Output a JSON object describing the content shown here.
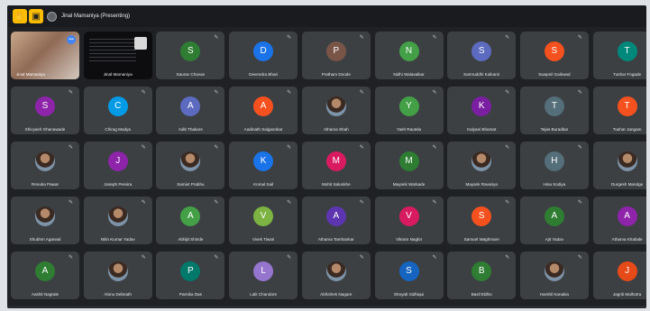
{
  "topbar": {
    "presenter_label": "Jinal Mamaniya (Presenting)"
  },
  "colors": {
    "bg": "#202124",
    "tile": "#3c4043",
    "badge": "#4285f4"
  },
  "tiles": [
    {
      "name": "Jinal Mamaniya",
      "kind": "video"
    },
    {
      "name": "Jinal Mamaniya",
      "kind": "screen"
    },
    {
      "name": "Saurav Chavan",
      "initial": "S",
      "color": "#2e7d32"
    },
    {
      "name": "Devendra Bhari",
      "initial": "D",
      "color": "#1a73e8"
    },
    {
      "name": "Pratham Doode",
      "initial": "P",
      "color": "#795548"
    },
    {
      "name": "Nidhi Walavalkar",
      "initial": "N",
      "color": "#43a047"
    },
    {
      "name": "Samruddhi Kulkarni",
      "initial": "S",
      "color": "#5c6bc0"
    },
    {
      "name": "Swapnil Gaikwad",
      "initial": "S",
      "color": "#f4511e"
    },
    {
      "name": "Tushar Fogade",
      "initial": "T",
      "color": "#00897b"
    },
    {
      "name": "Shivyash Ghanawade",
      "initial": "S",
      "color": "#8e24aa"
    },
    {
      "name": "Chirag Madya",
      "initial": "C",
      "color": "#039be5"
    },
    {
      "name": "Aditi Thakare",
      "initial": "A",
      "color": "#5c6bc0"
    },
    {
      "name": "Aadinath Salgaonkar",
      "initial": "A",
      "color": "#f4511e"
    },
    {
      "name": "Atharva Shah",
      "kind": "photo"
    },
    {
      "name": "Yash Rautela",
      "initial": "Y",
      "color": "#43a047"
    },
    {
      "name": "Kalyani Bharsat",
      "initial": "K",
      "color": "#7b1fa2"
    },
    {
      "name": "Tejas Buradkar",
      "initial": "T",
      "color": "#546e7a"
    },
    {
      "name": "Tushar Jangam",
      "initial": "T",
      "color": "#f4511e"
    },
    {
      "name": "Renuka Pawar",
      "kind": "photo"
    },
    {
      "name": "Joseph Pereira",
      "initial": "J",
      "color": "#8e24aa"
    },
    {
      "name": "Samiet Prabhu",
      "kind": "photo"
    },
    {
      "name": "Komal Sail",
      "initial": "K",
      "color": "#1a73e8"
    },
    {
      "name": "Mohit Salunkhe",
      "initial": "M",
      "color": "#d81b60"
    },
    {
      "name": "Mayank Warkade",
      "initial": "M",
      "color": "#2e7d32"
    },
    {
      "name": "Mayank Ravariya",
      "kind": "photo"
    },
    {
      "name": "Hina Sodiya",
      "initial": "H",
      "color": "#546e7a"
    },
    {
      "name": "Durgesh Mandge",
      "kind": "photo"
    },
    {
      "name": "Shubhm Agarwal",
      "kind": "photo"
    },
    {
      "name": "Nitin Kumar Yadav",
      "kind": "photo"
    },
    {
      "name": "Abhijit Shinde",
      "initial": "A",
      "color": "#43a047"
    },
    {
      "name": "Vivek Tiwari",
      "initial": "V",
      "color": "#7cb342"
    },
    {
      "name": "Atharva Tamhankar",
      "initial": "A",
      "color": "#5e35b1"
    },
    {
      "name": "Vikram Naglot",
      "initial": "V",
      "color": "#d81b60"
    },
    {
      "name": "Samuel Waghmare",
      "initial": "S",
      "color": "#f4511e"
    },
    {
      "name": "Ajit Yadav",
      "initial": "A",
      "color": "#2e7d32"
    },
    {
      "name": "Atharva Khabale",
      "initial": "A",
      "color": "#8e24aa"
    },
    {
      "name": "Aashit Nagrale",
      "initial": "A",
      "color": "#2e7d32"
    },
    {
      "name": "Alonu Debnath",
      "kind": "photo"
    },
    {
      "name": "Parnika Das",
      "initial": "P",
      "color": "#00796b"
    },
    {
      "name": "Lalit Chandore",
      "initial": "L",
      "color": "#9575cd"
    },
    {
      "name": "Abhishek Nagare",
      "kind": "photo"
    },
    {
      "name": "Shoyab Sidhiqui",
      "initial": "S",
      "color": "#1565c0"
    },
    {
      "name": "Basil Eldho",
      "initial": "B",
      "color": "#2e7d32"
    },
    {
      "name": "Harshil Kanakia",
      "kind": "photo"
    },
    {
      "name": "Jagriti Malhotra",
      "initial": "J",
      "color": "#e64a19"
    }
  ]
}
